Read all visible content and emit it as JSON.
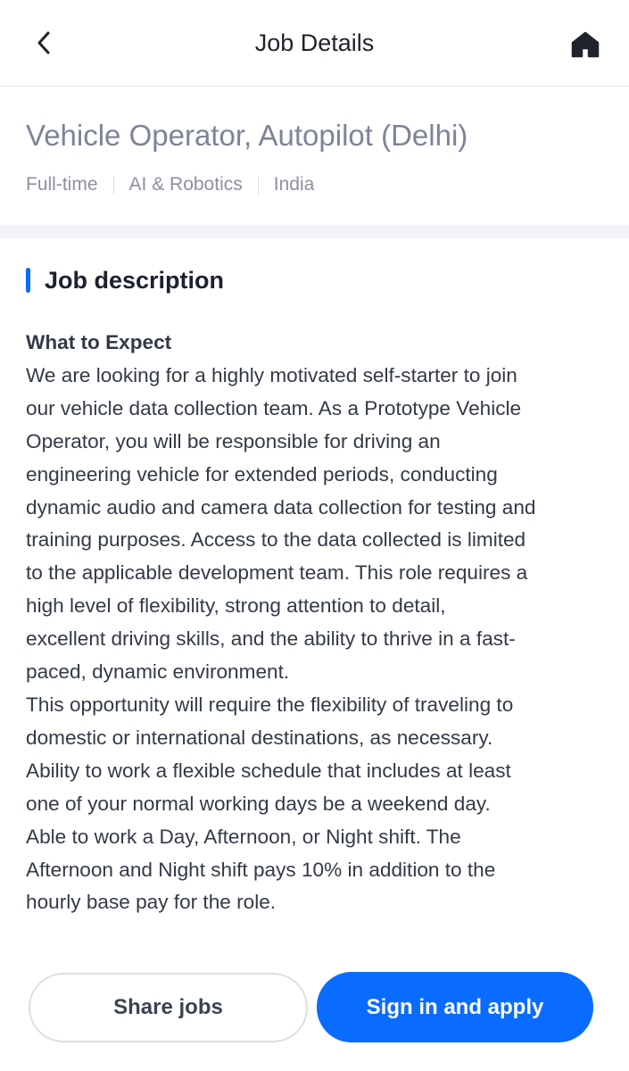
{
  "nav": {
    "title": "Job Details",
    "back_icon": "chevron-left-icon",
    "home_icon": "home-icon"
  },
  "job": {
    "title": "Vehicle Operator, Autopilot (Delhi)",
    "meta": [
      "Full-time",
      "AI & Robotics",
      "India"
    ]
  },
  "section": {
    "heading": "Job description",
    "accent_color": "#0a6cff"
  },
  "description": {
    "subheading": "What to Expect",
    "lines": [
      "We are looking for a highly motivated self-starter to join",
      "our vehicle data collection team. As a Prototype Vehicle",
      "Operator, you will be responsible for driving an",
      "engineering vehicle for extended periods, conducting",
      "dynamic audio and camera data collection for testing and",
      "training purposes. Access to the data collected is limited",
      "to the applicable development team. This role requires a",
      "high level of flexibility, strong attention to detail,",
      "excellent driving skills, and the ability to thrive in a fast-",
      "paced, dynamic environment.",
      "This opportunity will require the flexibility of traveling to",
      "domestic or international destinations, as necessary.",
      "Ability to work a flexible schedule that includes at least",
      "one of your normal working days be a weekend day.",
      "Able to work a Day, Afternoon, or Night shift. The",
      "Afternoon and Night shift pays 10% in addition to the",
      "hourly base pay for the role."
    ]
  },
  "actions": {
    "share_label": "Share jobs",
    "apply_label": "Sign in and apply",
    "primary_color": "#0a6cff"
  }
}
